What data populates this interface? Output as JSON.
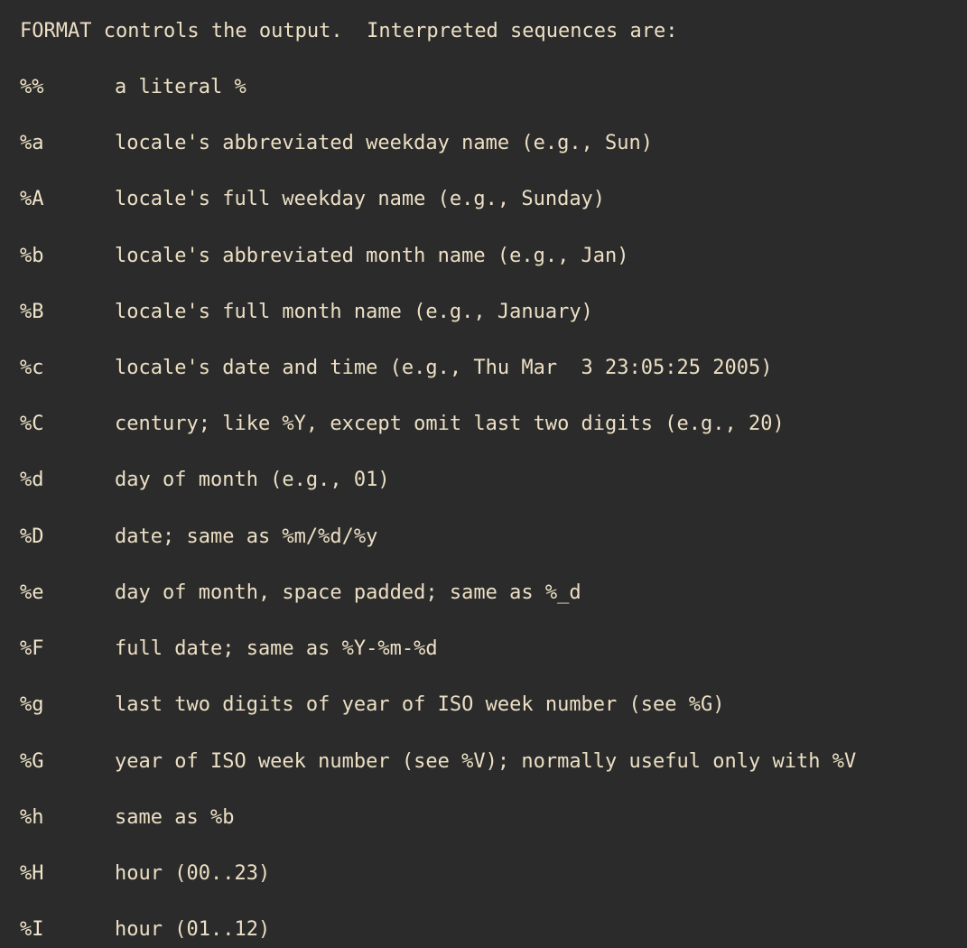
{
  "header": "FORMAT controls the output.  Interpreted sequences are:",
  "rows": [
    {
      "spec": "%%",
      "desc": "a literal %"
    },
    {
      "spec": "%a",
      "desc": "locale's abbreviated weekday name (e.g., Sun)"
    },
    {
      "spec": "%A",
      "desc": "locale's full weekday name (e.g., Sunday)"
    },
    {
      "spec": "%b",
      "desc": "locale's abbreviated month name (e.g., Jan)"
    },
    {
      "spec": "%B",
      "desc": "locale's full month name (e.g., January)"
    },
    {
      "spec": "%c",
      "desc": "locale's date and time (e.g., Thu Mar  3 23:05:25 2005)"
    },
    {
      "spec": "%C",
      "desc": "century; like %Y, except omit last two digits (e.g., 20)"
    },
    {
      "spec": "%d",
      "desc": "day of month (e.g., 01)"
    },
    {
      "spec": "%D",
      "desc": "date; same as %m/%d/%y"
    },
    {
      "spec": "%e",
      "desc": "day of month, space padded; same as %_d"
    },
    {
      "spec": "%F",
      "desc": "full date; same as %Y-%m-%d"
    },
    {
      "spec": "%g",
      "desc": "last two digits of year of ISO week number (see %G)"
    },
    {
      "spec": "%G",
      "desc": "year of ISO week number (see %V); normally useful only with %V"
    },
    {
      "spec": "%h",
      "desc": "same as %b"
    },
    {
      "spec": "%H",
      "desc": "hour (00..23)"
    },
    {
      "spec": "%I",
      "desc": "hour (01..12)"
    }
  ]
}
